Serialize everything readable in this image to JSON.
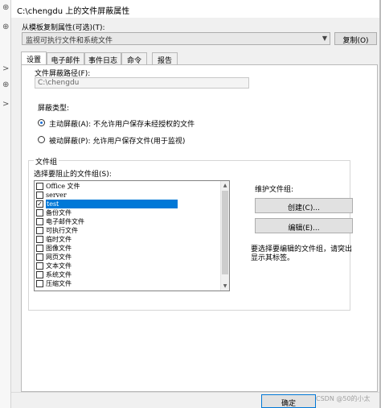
{
  "window": {
    "title": "C:\\chengdu 上的文件屏蔽属性"
  },
  "template": {
    "label": "从模板复制属性(可选)(T):",
    "selected_value": "监视可执行文件和系统文件",
    "copy_button": "复制(O)"
  },
  "tabs": [
    {
      "label": "设置",
      "active": true
    },
    {
      "label": "电子邮件",
      "active": false
    },
    {
      "label": "事件日志",
      "active": false
    },
    {
      "label": "命令",
      "active": false
    },
    {
      "label": "报告",
      "active": false
    }
  ],
  "settings": {
    "path_label": "文件屏蔽路径(F):",
    "path_value": "C:\\chengdu",
    "screening_type_label": "屏蔽类型:",
    "active_screening": "主动屏蔽(A): 不允许用户保存未经授权的文件",
    "passive_screening": "被动屏蔽(P): 允许用户保存文件(用于监视)",
    "active_selected": true
  },
  "file_groups": {
    "group_label": "文件组",
    "select_label": "选择要阻止的文件组(S):",
    "items": [
      {
        "label": "Office 文件",
        "checked": false,
        "selected": false
      },
      {
        "label": "server",
        "checked": false,
        "selected": false
      },
      {
        "label": "test",
        "checked": true,
        "selected": true
      },
      {
        "label": "备份文件",
        "checked": false,
        "selected": false
      },
      {
        "label": "电子邮件文件",
        "checked": false,
        "selected": false
      },
      {
        "label": "可执行文件",
        "checked": false,
        "selected": false
      },
      {
        "label": "临时文件",
        "checked": false,
        "selected": false
      },
      {
        "label": "图像文件",
        "checked": false,
        "selected": false
      },
      {
        "label": "网页文件",
        "checked": false,
        "selected": false
      },
      {
        "label": "文本文件",
        "checked": false,
        "selected": false
      },
      {
        "label": "系统文件",
        "checked": false,
        "selected": false
      },
      {
        "label": "压缩文件",
        "checked": false,
        "selected": false
      }
    ],
    "maintain_label": "维护文件组:",
    "create_button": "创建(C)...",
    "edit_button": "编辑(E)...",
    "hint": "要选择要编辑的文件组，请突出显示其标签。"
  },
  "footer": {
    "ok_button": "确定",
    "watermark": "CSDN @50的小太"
  },
  "left_strip": {
    "marks": [
      "⊕",
      "⊕",
      ">",
      "⊕",
      ">"
    ]
  }
}
